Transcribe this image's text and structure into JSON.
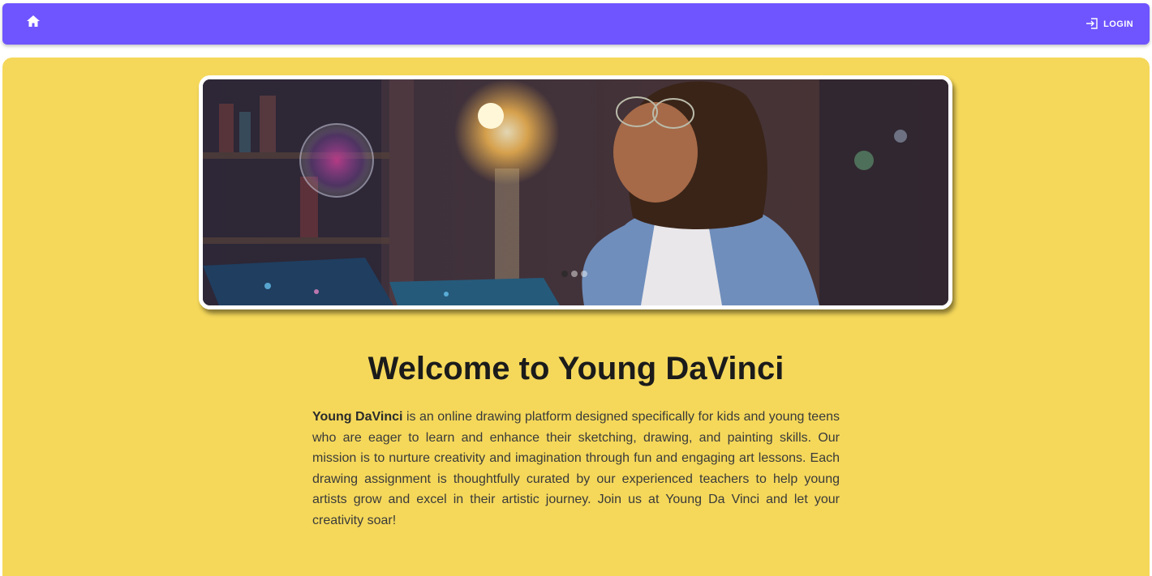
{
  "appbar": {
    "home_icon": "home-icon",
    "login_icon": "login-icon",
    "login_label": "LOGIN",
    "color": "#6e55ff"
  },
  "hero": {
    "image_alt": "Girl with curly hair and glasses drawing on a tablet",
    "dots_count": 3,
    "active_dot": 1
  },
  "welcome": {
    "title": "Welcome to Young DaVinci",
    "brand": "Young DaVinci",
    "body": " is an online drawing platform designed specifically for kids and young teens who are eager to learn and enhance their sketching, drawing, and painting skills. Our mission is to nurture creativity and imagination through fun and engaging art lessons. Each drawing assignment is thoughtfully curated by our experienced teachers to help young artists grow and excel in their artistic journey. Join us at Young Da Vinci and let your creativity soar!"
  },
  "colors": {
    "background": "#f5d85a",
    "text": "#1b1b1b"
  }
}
